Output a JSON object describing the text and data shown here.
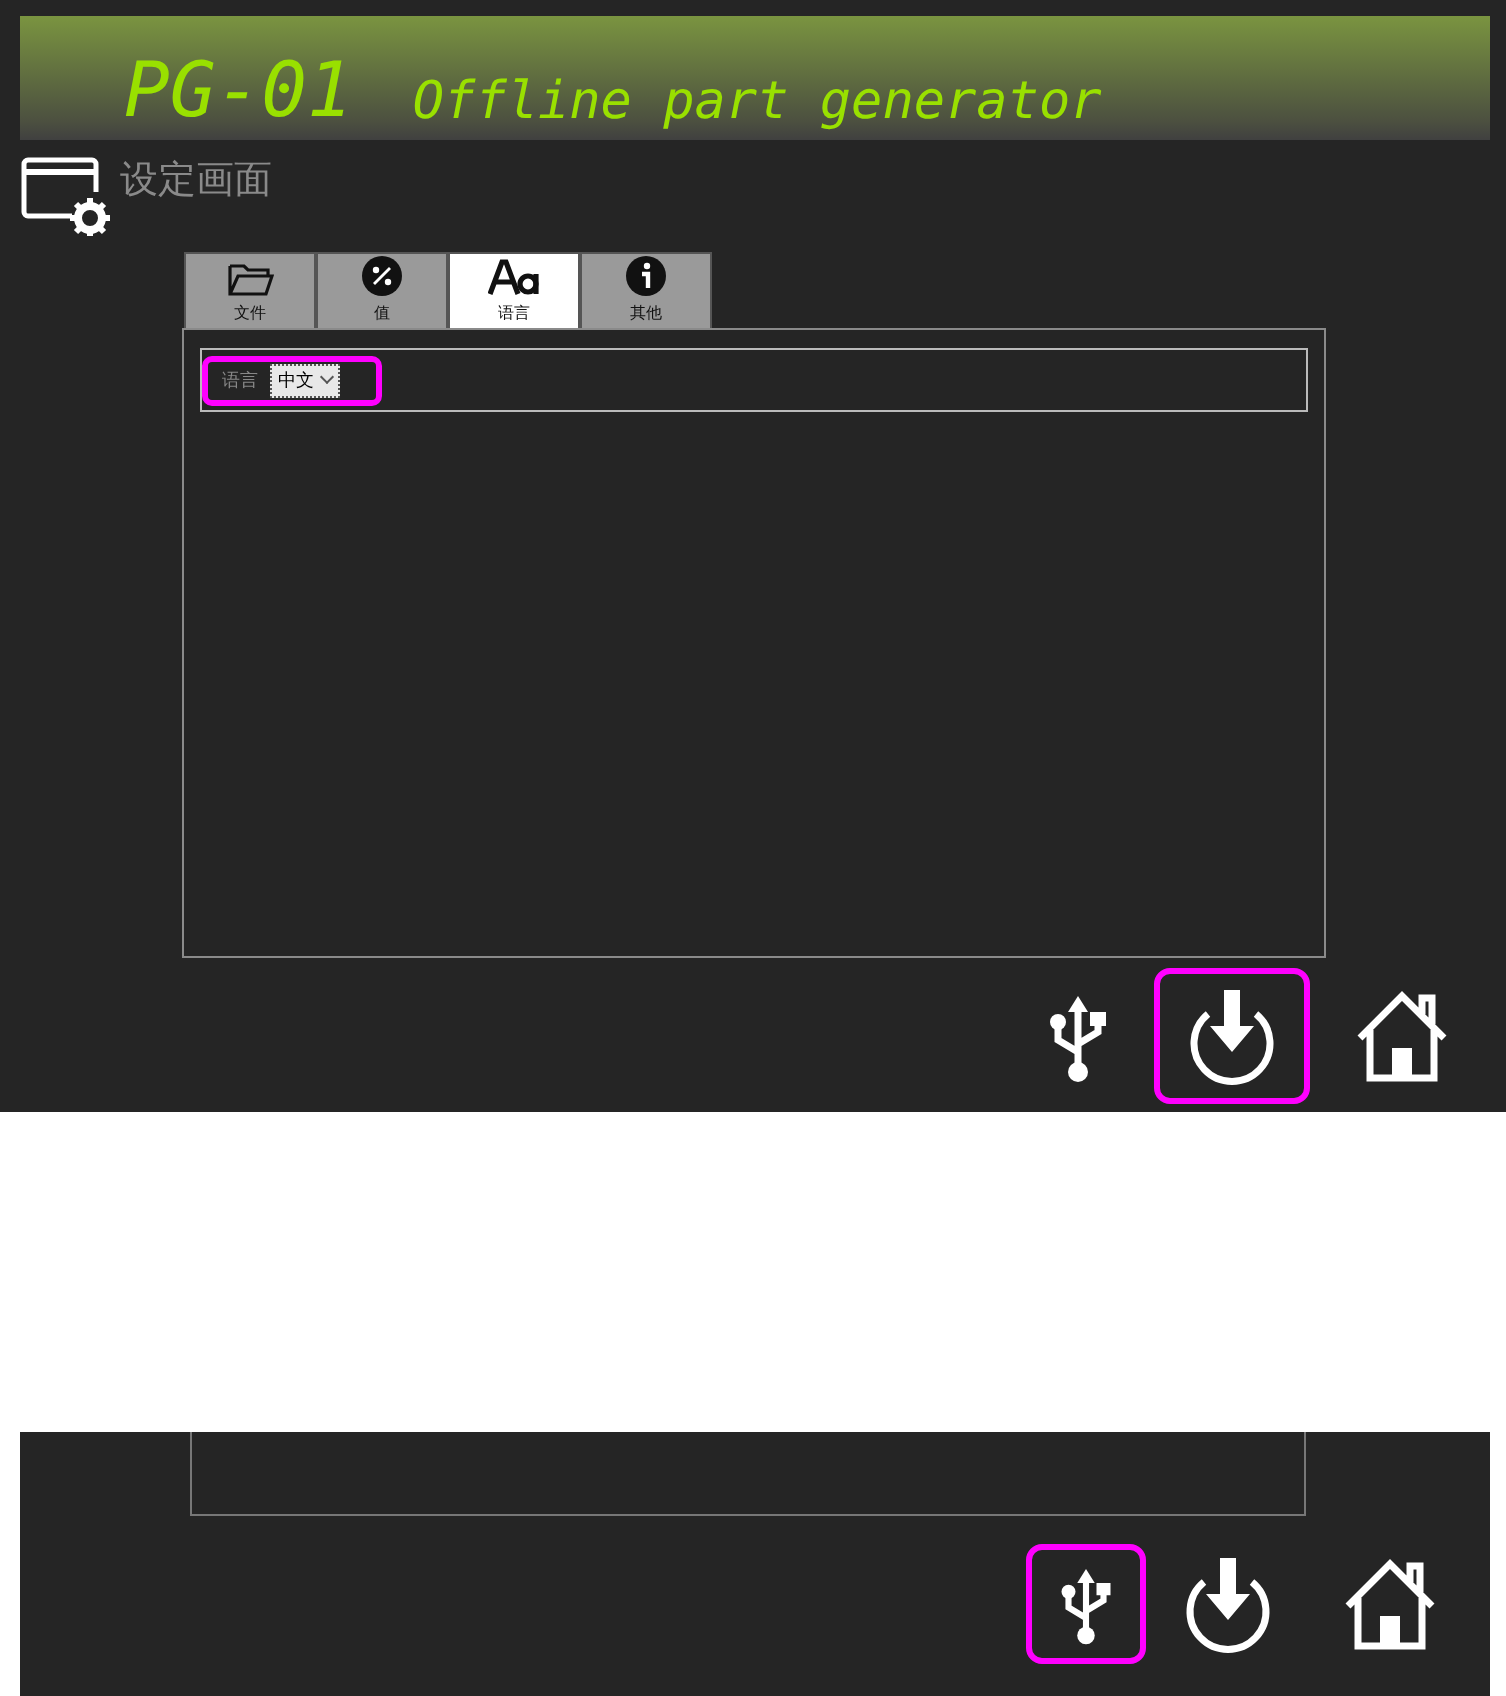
{
  "header": {
    "code": "PG-01",
    "title": "Offline part generator"
  },
  "screen": {
    "title": "设定画面"
  },
  "tabs": [
    {
      "kind": "folder",
      "label": "文件",
      "selected": false
    },
    {
      "kind": "percent",
      "label": "值",
      "selected": false
    },
    {
      "kind": "font",
      "label": "语言",
      "selected": true
    },
    {
      "kind": "info",
      "label": "其他",
      "selected": false
    }
  ],
  "language_setting": {
    "label": "语言",
    "value": "中文",
    "highlighted": true
  },
  "toolbar": [
    {
      "kind": "usb",
      "highlighted": false
    },
    {
      "kind": "download",
      "highlighted": true
    },
    {
      "kind": "home",
      "highlighted": false
    }
  ],
  "second_view": {
    "toolbar": [
      {
        "kind": "usb",
        "highlighted": true
      },
      {
        "kind": "download",
        "highlighted": false
      },
      {
        "kind": "home",
        "highlighted": false
      }
    ]
  }
}
